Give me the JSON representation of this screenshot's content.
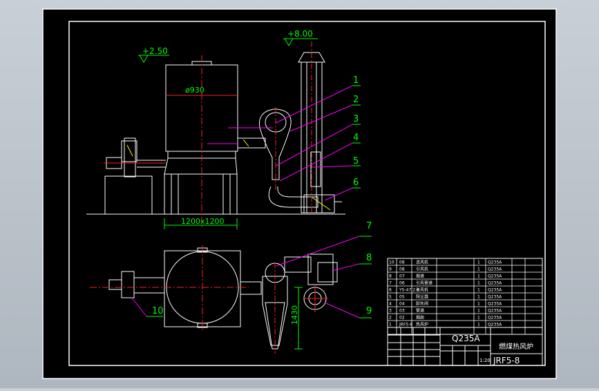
{
  "drawing": {
    "elevations": {
      "top_tank": "+2.50",
      "chimney": "+8.00"
    },
    "dimensions": {
      "diameter": "ø930",
      "base": "1200x1200",
      "height": "1430"
    },
    "callouts": [
      "1",
      "2",
      "3",
      "4",
      "5",
      "6",
      "7",
      "8",
      "9",
      "10"
    ]
  },
  "title_block": {
    "material": "Q235A",
    "title": "燃煤热风炉",
    "drawing_no": "JRF5-8",
    "scale": "1:20"
  },
  "parts_list": {
    "rows": [
      {
        "no": "10",
        "code": "08",
        "name": "送风机",
        "qty": "1",
        "material": "Q235A"
      },
      {
        "no": "9",
        "code": "08",
        "name": "引风机",
        "qty": "1",
        "material": "Q235A"
      },
      {
        "no": "8",
        "code": "07",
        "name": "烟道",
        "qty": "1",
        "material": "Q235A"
      },
      {
        "no": "7",
        "code": "06",
        "name": "引风管道",
        "qty": "1",
        "material": "Q235A"
      },
      {
        "no": "6",
        "code": "Y5-47 2.8",
        "name": "引风机",
        "qty": "1",
        "material": "Q235A"
      },
      {
        "no": "5",
        "code": "05",
        "name": "除尘器",
        "qty": "1",
        "material": "Q235A"
      },
      {
        "no": "4",
        "code": "04",
        "name": "卸灰阀",
        "qty": "1",
        "material": "Q235A"
      },
      {
        "no": "3",
        "code": "03",
        "name": "管道",
        "qty": "1",
        "material": "Q235A"
      },
      {
        "no": "2",
        "code": "02",
        "name": "烟囱",
        "qty": "1",
        "material": "Q235A"
      },
      {
        "no": "1",
        "code": "JRF5-8",
        "name": "热风炉",
        "qty": "1",
        "material": "Q235A"
      }
    ]
  },
  "colors": {
    "background": "#000000",
    "line": "#ffffff",
    "center_line": "#ff2020",
    "dimension": "#00ff00",
    "leader": "#ff00ff",
    "hatch": "#ffff00"
  }
}
